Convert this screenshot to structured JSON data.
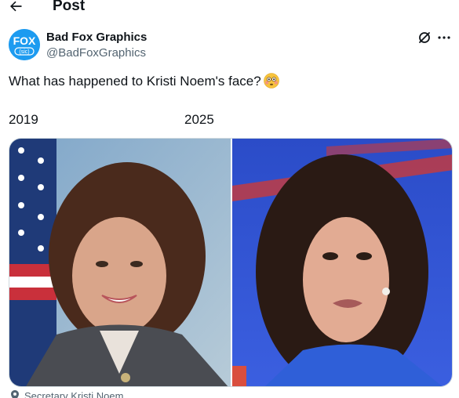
{
  "header": {
    "title": "Post",
    "back_icon": "arrow-left-icon"
  },
  "author": {
    "display_name": "Bad Fox Graphics",
    "handle": "@BadFoxGraphics",
    "avatar_logo": "FOX (sic)",
    "avatar_color": "#1d9bf0"
  },
  "actions": {
    "grok_icon": "grok-icon",
    "more_icon": "more-icon"
  },
  "tweet": {
    "text": "What has happened to Kristi Noem's face?",
    "emoji": "flushed-face-emoji"
  },
  "labels": {
    "left_year": "2019",
    "right_year": "2025"
  },
  "media": {
    "left_photo": "portrait-2019",
    "right_photo": "portrait-2025"
  },
  "location": {
    "icon": "location-pin-icon",
    "text": "Secretary Kristi Noem"
  },
  "colors": {
    "text": "#0f1419",
    "secondary": "#536471",
    "border": "#cfd9de",
    "accent": "#1d9bf0"
  }
}
